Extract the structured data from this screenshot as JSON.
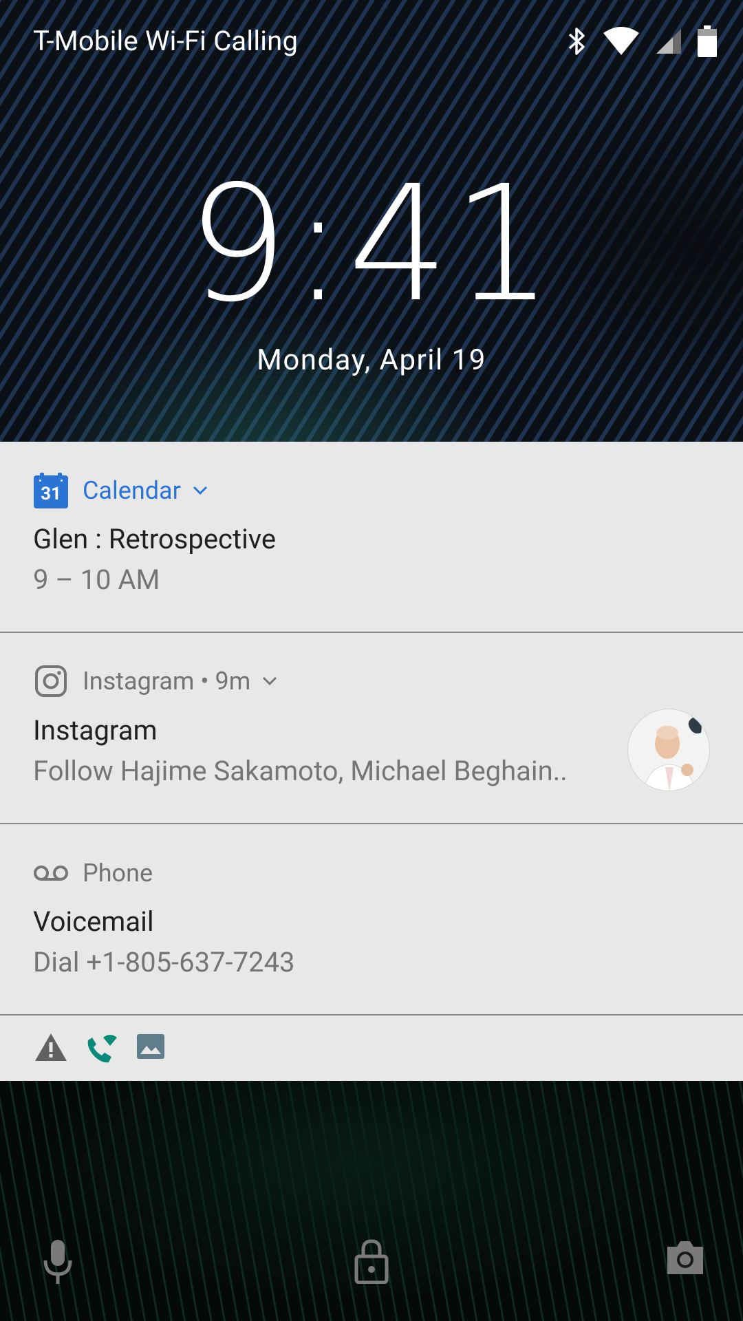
{
  "status_bar": {
    "carrier": "T-Mobile Wi-Fi Calling",
    "icons": [
      "bluetooth-icon",
      "wifi-icon",
      "cellular-signal-icon",
      "battery-icon"
    ]
  },
  "lockscreen": {
    "time": "9:41",
    "date": "Monday, April 19"
  },
  "notifications": [
    {
      "app": "Calendar",
      "icon": "calendar-icon",
      "icon_text": "31",
      "accent": "#2a74d6",
      "title": "Glen : Retrospective",
      "text": "9 – 10 AM"
    },
    {
      "app": "Instagram",
      "meta": " • 9m",
      "icon": "instagram-icon",
      "title": "Instagram",
      "text": "Follow Hajime Sakamoto, Michael Beghain..",
      "has_avatar": true
    },
    {
      "app": "Phone",
      "icon": "voicemail-icon",
      "title": "Voicemail",
      "text": "Dial +1-805-637-7243"
    }
  ],
  "overflow_icons": [
    "warning-icon",
    "wifi-call-icon",
    "image-icon"
  ],
  "bottom_shortcuts": [
    "microphone-icon",
    "lock-icon",
    "camera-icon"
  ],
  "colors": {
    "panel_bg": "#e8e8e8",
    "calendar_blue": "#2a74d6",
    "wifi_call_teal": "#0a8a7a"
  }
}
